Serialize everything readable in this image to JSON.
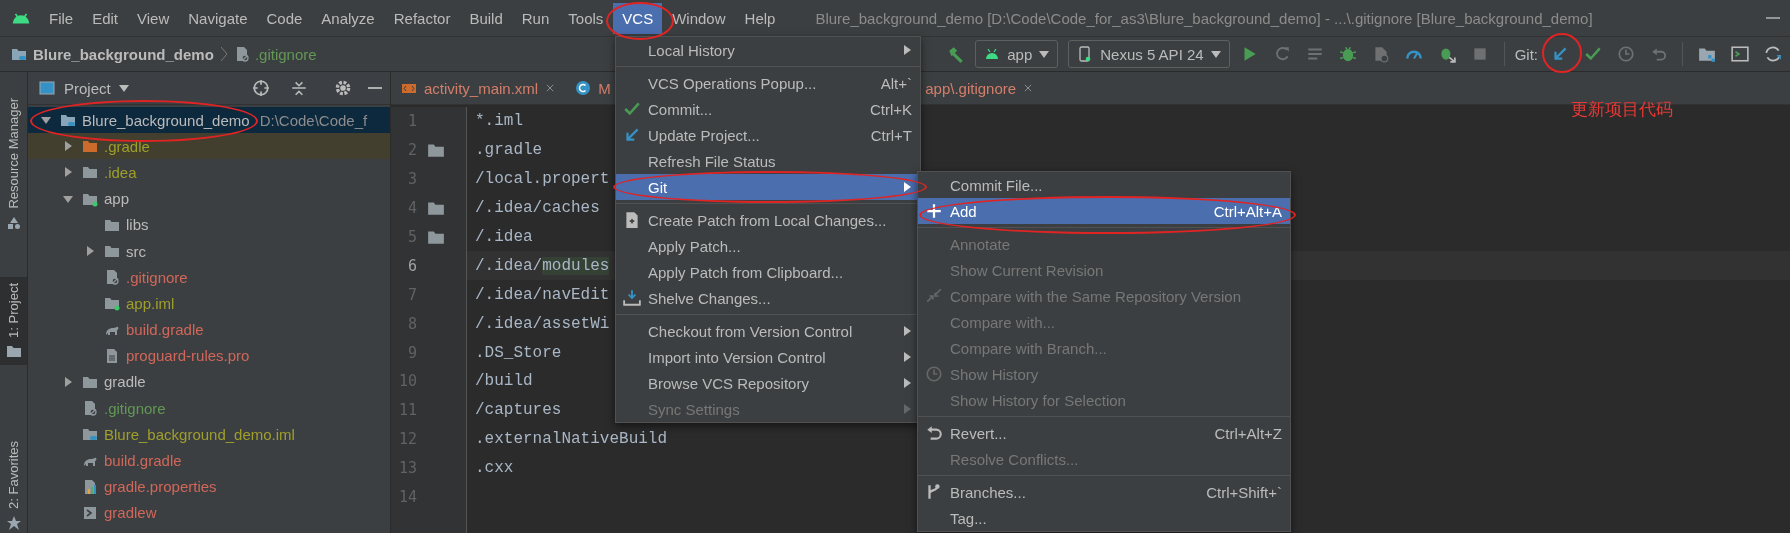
{
  "window": {
    "title": "Blure_background_demo [D:\\Code\\Code_for_as3\\Blure_background_demo] - ...\\.gitignore [Blure_background_demo]"
  },
  "menu_bar": [
    {
      "label": "File",
      "selected": false
    },
    {
      "label": "Edit",
      "selected": false
    },
    {
      "label": "View",
      "selected": false
    },
    {
      "label": "Navigate",
      "selected": false
    },
    {
      "label": "Code",
      "selected": false
    },
    {
      "label": "Analyze",
      "selected": false
    },
    {
      "label": "Refactor",
      "selected": false
    },
    {
      "label": "Build",
      "selected": false
    },
    {
      "label": "Run",
      "selected": false
    },
    {
      "label": "Tools",
      "selected": false
    },
    {
      "label": "VCS",
      "selected": true
    },
    {
      "label": "Window",
      "selected": false
    },
    {
      "label": "Help",
      "selected": false
    }
  ],
  "breadcrumb": [
    {
      "label": "Blure_background_demo",
      "kind": "project"
    },
    {
      "label": ".gitignore",
      "kind": "gitignore"
    }
  ],
  "toolbar": {
    "run_config": "app",
    "device": "Nexus 5 API 24",
    "git_label": "Git:",
    "run_tools": [
      {
        "kind": "run",
        "disabled": false
      },
      {
        "kind": "rerun",
        "disabled": true
      },
      {
        "kind": "list",
        "disabled": true
      },
      {
        "kind": "debug",
        "disabled": false
      },
      {
        "kind": "profile",
        "disabled": true
      },
      {
        "kind": "gauge",
        "disabled": false
      },
      {
        "kind": "attach",
        "disabled": false
      },
      {
        "kind": "stop",
        "disabled": true
      }
    ],
    "git_tools": [
      {
        "kind": "update",
        "disabled": false
      },
      {
        "kind": "commit",
        "disabled": false
      },
      {
        "kind": "history",
        "disabled": true
      },
      {
        "kind": "rollback",
        "disabled": true
      }
    ],
    "tool_windows": [
      {
        "kind": "structure",
        "disabled": false
      },
      {
        "kind": "terminal",
        "disabled": false
      },
      {
        "kind": "sync",
        "disabled": false
      }
    ]
  },
  "side_strip": [
    {
      "label": "Resource Manager",
      "kind": "resources",
      "selected": false
    },
    {
      "label": "1: Project",
      "kind": "project",
      "selected": true
    },
    {
      "label": "2: Favorites",
      "kind": "favorites",
      "selected": false
    }
  ],
  "project_panel": {
    "title": "Project",
    "tree": [
      {
        "label": "Blure_background_demo",
        "path": "D:\\Code\\Code_f",
        "kind": "module",
        "color": "#bbbbbb",
        "expanded": true,
        "selected": true,
        "highlighted": false,
        "children": [
          {
            "label": ".gradle",
            "kind": "excluded",
            "color": "#9f9f2c",
            "expanded": false,
            "selected": false,
            "highlighted": true
          },
          {
            "label": ".idea",
            "kind": "folder",
            "color": "#9f9f2c",
            "expanded": false,
            "selected": false,
            "highlighted": false
          },
          {
            "label": "app",
            "kind": "module-folder",
            "color": "#bbbbbb",
            "expanded": true,
            "selected": false,
            "highlighted": false,
            "children": [
              {
                "label": "libs",
                "kind": "folder",
                "color": "#bbbbbb",
                "selected": false,
                "highlighted": false
              },
              {
                "label": "src",
                "kind": "folder",
                "color": "#bbbbbb",
                "expanded": false,
                "selected": false,
                "highlighted": false
              },
              {
                "label": ".gitignore",
                "kind": "gitignore",
                "color": "#d1675a",
                "selected": false,
                "highlighted": false
              },
              {
                "label": "app.iml",
                "kind": "iml",
                "color": "#9f9f2c",
                "selected": false,
                "highlighted": false
              },
              {
                "label": "build.gradle",
                "kind": "gradle",
                "color": "#d1675a",
                "selected": false,
                "highlighted": false
              },
              {
                "label": "proguard-rules.pro",
                "kind": "text",
                "color": "#d1675a",
                "selected": false,
                "highlighted": false
              }
            ]
          },
          {
            "label": "gradle",
            "kind": "folder",
            "color": "#bbbbbb",
            "expanded": false,
            "selected": false,
            "highlighted": false
          },
          {
            "label": ".gitignore",
            "kind": "gitignore",
            "color": "#629755",
            "selected": false,
            "highlighted": false
          },
          {
            "label": "Blure_background_demo.iml",
            "kind": "module-iml",
            "color": "#9f9f2c",
            "selected": false,
            "highlighted": false
          },
          {
            "label": "build.gradle",
            "kind": "gradle",
            "color": "#d1675a",
            "selected": false,
            "highlighted": false
          },
          {
            "label": "gradle.properties",
            "kind": "properties",
            "color": "#d1675a",
            "selected": false,
            "highlighted": false
          },
          {
            "label": "gradlew",
            "kind": "script",
            "color": "#d1675a",
            "selected": false,
            "highlighted": false
          }
        ]
      }
    ]
  },
  "editor": {
    "tabs": [
      {
        "label": "activity_main.xml",
        "kind": "xml",
        "close": true
      },
      {
        "label": "M",
        "kind": "class",
        "close": false
      },
      {
        "label": "app\\.gitignore",
        "kind": "none",
        "close": true
      }
    ],
    "lines": [
      {
        "number": "1",
        "text": "*.iml",
        "folder": false,
        "current": false
      },
      {
        "number": "2",
        "text": ".gradle",
        "folder": true,
        "current": false
      },
      {
        "number": "3",
        "text": "/local.propert",
        "folder": false,
        "current": false
      },
      {
        "number": "4",
        "text": "/.idea/caches",
        "folder": true,
        "current": false
      },
      {
        "number": "5",
        "text": "/.idea",
        "folder": true,
        "current": false
      },
      {
        "number": "6",
        "text": "/.idea/",
        "highlight": "modules",
        "folder": false,
        "current": true
      },
      {
        "number": "7",
        "text": "/.idea/navEdit",
        "folder": false,
        "current": false
      },
      {
        "number": "8",
        "text": "/.idea/assetWi",
        "folder": false,
        "current": false
      },
      {
        "number": "9",
        "text": ".DS_Store",
        "folder": false,
        "current": false
      },
      {
        "number": "10",
        "text": "/build",
        "folder": false,
        "current": false
      },
      {
        "number": "11",
        "text": "/captures",
        "folder": false,
        "current": false
      },
      {
        "number": "12",
        "text": ".externalNativeBuild",
        "folder": false,
        "current": false
      },
      {
        "number": "13",
        "text": ".cxx",
        "folder": false,
        "current": false
      },
      {
        "number": "14",
        "folder": false,
        "current": false
      }
    ]
  },
  "vcs_menu": [
    {
      "kind": "plain",
      "label": "Local History",
      "submenu": true,
      "disabled": false,
      "selected": false
    },
    {
      "kind": "separator"
    },
    {
      "kind": "plain",
      "label": "VCS Operations Popup...",
      "shortcut": "Alt+`",
      "submenu": false,
      "disabled": false,
      "selected": false
    },
    {
      "kind": "check",
      "label": "Commit...",
      "shortcut": "Ctrl+K",
      "submenu": false,
      "disabled": false,
      "selected": false
    },
    {
      "kind": "update",
      "label": "Update Project...",
      "shortcut": "Ctrl+T",
      "submenu": false,
      "disabled": false,
      "selected": false
    },
    {
      "kind": "plain",
      "label": "Refresh File Status",
      "submenu": false,
      "disabled": false,
      "selected": false
    },
    {
      "kind": "plain",
      "label": "Git",
      "submenu": true,
      "disabled": false,
      "selected": true
    },
    {
      "kind": "separator"
    },
    {
      "kind": "patch",
      "label": "Create Patch from Local Changes...",
      "submenu": false,
      "disabled": false,
      "selected": false
    },
    {
      "kind": "plain",
      "label": "Apply Patch...",
      "submenu": false,
      "disabled": false,
      "selected": false
    },
    {
      "kind": "plain",
      "label": "Apply Patch from Clipboard...",
      "submenu": false,
      "disabled": false,
      "selected": false
    },
    {
      "kind": "shelve",
      "label": "Shelve Changes...",
      "submenu": false,
      "disabled": false,
      "selected": false
    },
    {
      "kind": "separator"
    },
    {
      "kind": "plain",
      "label": "Checkout from Version Control",
      "submenu": true,
      "disabled": false,
      "selected": false
    },
    {
      "kind": "plain",
      "label": "Import into Version Control",
      "submenu": true,
      "disabled": false,
      "selected": false
    },
    {
      "kind": "plain",
      "label": "Browse VCS Repository",
      "submenu": true,
      "disabled": false,
      "selected": false
    },
    {
      "kind": "plain",
      "label": "Sync Settings",
      "submenu": true,
      "disabled": true,
      "selected": false
    }
  ],
  "git_submenu": [
    {
      "kind": "plain",
      "label": "Commit File...",
      "submenu": false,
      "disabled": false,
      "selected": false
    },
    {
      "kind": "add",
      "label": "Add",
      "shortcut": "Ctrl+Alt+A",
      "submenu": false,
      "disabled": false,
      "selected": true
    },
    {
      "kind": "separator"
    },
    {
      "kind": "plain",
      "label": "Annotate",
      "submenu": false,
      "disabled": true,
      "selected": false
    },
    {
      "kind": "plain",
      "label": "Show Current Revision",
      "submenu": false,
      "disabled": true,
      "selected": false
    },
    {
      "kind": "compare",
      "label": "Compare with the Same Repository Version",
      "submenu": false,
      "disabled": true,
      "selected": false
    },
    {
      "kind": "plain",
      "label": "Compare with...",
      "submenu": false,
      "disabled": true,
      "selected": false
    },
    {
      "kind": "plain",
      "label": "Compare with Branch...",
      "submenu": false,
      "disabled": true,
      "selected": false
    },
    {
      "kind": "history",
      "label": "Show History",
      "submenu": false,
      "disabled": true,
      "selected": false
    },
    {
      "kind": "plain",
      "label": "Show History for Selection",
      "submenu": false,
      "disabled": true,
      "selected": false
    },
    {
      "kind": "separator"
    },
    {
      "kind": "revert",
      "label": "Revert...",
      "shortcut": "Ctrl+Alt+Z",
      "submenu": false,
      "disabled": false,
      "selected": false
    },
    {
      "kind": "plain",
      "label": "Resolve Conflicts...",
      "submenu": false,
      "disabled": true,
      "selected": false
    },
    {
      "kind": "separator"
    },
    {
      "kind": "branch",
      "label": "Branches...",
      "shortcut": "Ctrl+Shift+`",
      "submenu": false,
      "disabled": false,
      "selected": false
    },
    {
      "kind": "plain",
      "label": "Tag...",
      "submenu": false,
      "disabled": false,
      "selected": false
    }
  ],
  "annotation": "更新项目代码"
}
